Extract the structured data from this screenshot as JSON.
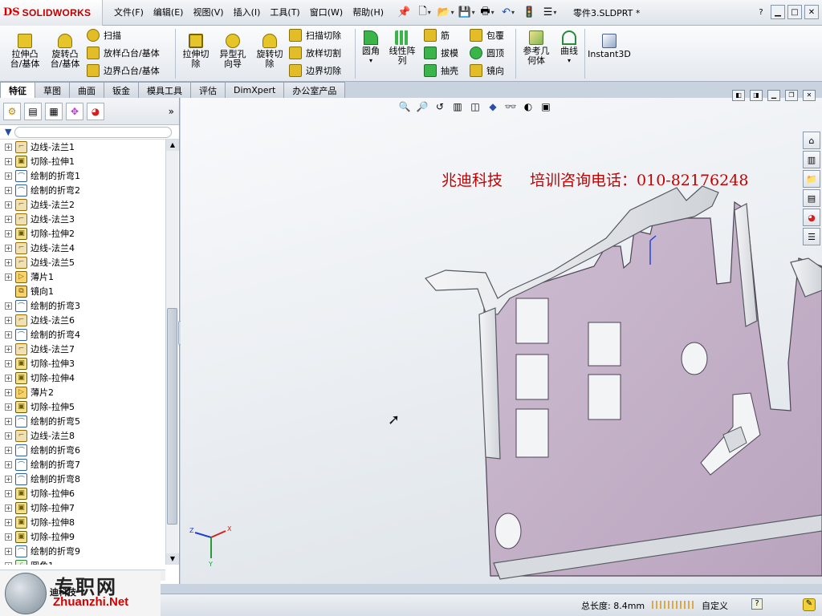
{
  "app": {
    "brand_symbol": "DS",
    "brand_name": "SOLIDWORKS"
  },
  "menubar": [
    "文件(F)",
    "编辑(E)",
    "视图(V)",
    "插入(I)",
    "工具(T)",
    "窗口(W)",
    "帮助(H)"
  ],
  "document_title": "零件3.SLDPRT *",
  "toolbar_icons": [
    "pushpin-icon",
    "new-document-icon",
    "open-folder-icon",
    "save-icon",
    "print-icon",
    "undo-icon",
    "rebuild-icon",
    "options-icon"
  ],
  "command_manager": {
    "large": [
      {
        "label1": "拉伸凸",
        "label2": "台/基体"
      },
      {
        "label1": "旋转凸",
        "label2": "台/基体"
      },
      {
        "label1": "拉伸切",
        "label2": "除"
      },
      {
        "label1": "异型孔",
        "label2": "向导"
      },
      {
        "label1": "旋转切",
        "label2": "除"
      },
      {
        "label1": "圆角",
        "label2": ""
      },
      {
        "label1": "线性阵",
        "label2": "列"
      },
      {
        "label1": "参考几",
        "label2": "何体"
      },
      {
        "label1": "曲线",
        "label2": ""
      },
      {
        "label1": "Instant3D",
        "label2": ""
      }
    ],
    "small": [
      "扫描",
      "放样凸台/基体",
      "边界凸台/基体",
      "扫描切除",
      "放样切割",
      "边界切除",
      "筋",
      "拔模",
      "抽壳",
      "包覆",
      "圆顶",
      "镜向"
    ]
  },
  "tabs": [
    "特征",
    "草图",
    "曲面",
    "钣金",
    "模具工具",
    "评估",
    "DimXpert",
    "办公室产品"
  ],
  "feature_tree": [
    {
      "label": "边线-法兰1",
      "type": "flange"
    },
    {
      "label": "切除-拉伸1",
      "type": "cut"
    },
    {
      "label": "绘制的折弯1",
      "type": "bend"
    },
    {
      "label": "绘制的折弯2",
      "type": "bend"
    },
    {
      "label": "边线-法兰2",
      "type": "flange"
    },
    {
      "label": "边线-法兰3",
      "type": "flange"
    },
    {
      "label": "切除-拉伸2",
      "type": "cut"
    },
    {
      "label": "边线-法兰4",
      "type": "flange"
    },
    {
      "label": "边线-法兰5",
      "type": "flange"
    },
    {
      "label": "薄片1",
      "type": "tab"
    },
    {
      "label": "镜向1",
      "type": "mirror"
    },
    {
      "label": "绘制的折弯3",
      "type": "bend"
    },
    {
      "label": "边线-法兰6",
      "type": "flange"
    },
    {
      "label": "绘制的折弯4",
      "type": "bend"
    },
    {
      "label": "边线-法兰7",
      "type": "flange"
    },
    {
      "label": "切除-拉伸3",
      "type": "cut"
    },
    {
      "label": "切除-拉伸4",
      "type": "cut"
    },
    {
      "label": "薄片2",
      "type": "tab"
    },
    {
      "label": "切除-拉伸5",
      "type": "cut"
    },
    {
      "label": "绘制的折弯5",
      "type": "bend"
    },
    {
      "label": "边线-法兰8",
      "type": "flange"
    },
    {
      "label": "绘制的折弯6",
      "type": "bend"
    },
    {
      "label": "绘制的折弯7",
      "type": "bend"
    },
    {
      "label": "绘制的折弯8",
      "type": "bend"
    },
    {
      "label": "切除-拉伸6",
      "type": "cut"
    },
    {
      "label": "切除-拉伸7",
      "type": "cut"
    },
    {
      "label": "切除-拉伸8",
      "type": "cut"
    },
    {
      "label": "切除-拉伸9",
      "type": "cut"
    },
    {
      "label": "绘制的折弯9",
      "type": "bend"
    },
    {
      "label": "圆角1",
      "type": "fillet"
    }
  ],
  "banner": {
    "company": "兆迪科技",
    "hotline": "培训咨询电话：010-82176248"
  },
  "triad": {
    "x": "X",
    "y": "Y",
    "z": "Z"
  },
  "watermark": {
    "site": "专职网",
    "url": "Zhuanzhi.Net",
    "fragment": "迪科技"
  },
  "status": {
    "length": "总长度: 8.4mm",
    "units": "自定义",
    "help": "?"
  },
  "colors": {
    "part_face": "#c5b3c9",
    "part_edge": "#5a4d5e",
    "banner": "#c40000",
    "brand_red": "#d40000"
  }
}
